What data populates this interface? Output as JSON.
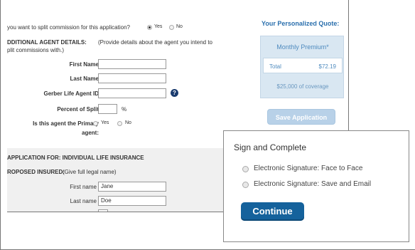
{
  "split": {
    "question": "you want to split commission for this application?",
    "yes": "Yes",
    "no": "No"
  },
  "agent_details": {
    "heading": "DDITIONAL AGENT DETAILS:",
    "desc1": "(Provide details about the agent you intend to",
    "desc2": "plit commissions with.)",
    "first_name_label": "First Name",
    "last_name_label": "Last Name",
    "agent_id_label": "Gerber Life Agent ID",
    "percent_label": "Percent of Split",
    "percent_unit": "%",
    "primary_label_1": "Is this agent the Primary",
    "primary_label_2": "agent:",
    "yes": "Yes",
    "no": "No",
    "help_glyph": "?"
  },
  "application": {
    "heading": "APPLICATION FOR: INDIVIDUAL LIFE INSURANCE",
    "insured_heading": "ROPOSED INSURED:",
    "insured_desc": "(Give full legal name)",
    "first_name_label": "First name",
    "first_name_value": "Jane",
    "last_name_label": "Last name",
    "last_name_value": "Doe"
  },
  "quote": {
    "title": "Your Personalized Quote:",
    "monthly_premium": "Monthly Premium*",
    "total_label": "Total",
    "total_value": "$72.19",
    "coverage": "$25,000 of coverage",
    "save_button": "Save Application"
  },
  "sign": {
    "title": "Sign and Complete",
    "option1": "Electronic Signature: Face to Face",
    "option2": "Electronic Signature: Save and Email",
    "continue": "Continue"
  },
  "icons": {
    "help": "help-circle-icon"
  },
  "colors": {
    "accent": "#15629c",
    "quote_text": "#2a6fad",
    "quote_bg": "#d9e7f2",
    "help_icon": "#1a3b6e"
  }
}
